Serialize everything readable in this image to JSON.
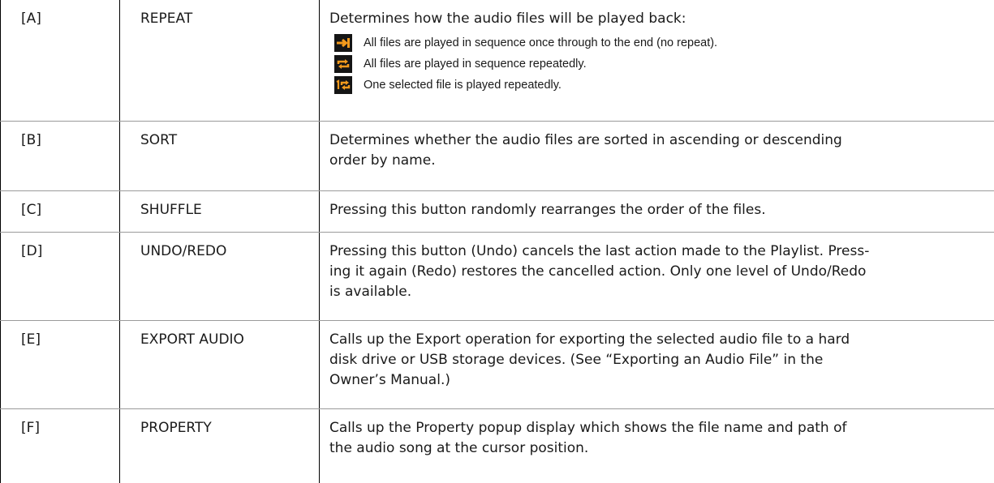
{
  "rows": [
    {
      "key": "[A]",
      "name": "REPEAT",
      "description": "Determines how the audio files will be played back:",
      "modes": [
        {
          "icon": "repeat-off-icon",
          "text": "All files are played in sequence once through to the end (no repeat)."
        },
        {
          "icon": "repeat-all-icon",
          "text": "All files are played in sequence repeatedly."
        },
        {
          "icon": "repeat-one-icon",
          "text": "One selected file is played repeatedly."
        }
      ]
    },
    {
      "key": "[B]",
      "name": "SORT",
      "description_lines": [
        "Determines whether the audio files are sorted in ascending or descending",
        "order by name."
      ]
    },
    {
      "key": "[C]",
      "name": "SHUFFLE",
      "description_lines": [
        "Pressing this button randomly rearranges the order of the files."
      ]
    },
    {
      "key": "[D]",
      "name": "UNDO/REDO",
      "description_lines": [
        "Pressing this button (Undo) cancels the last action made to the Playlist. Press-",
        "ing it again (Redo) restores the cancelled action. Only one level of Undo/Redo",
        "is available."
      ]
    },
    {
      "key": "[E]",
      "name": "EXPORT AUDIO",
      "description_lines": [
        "Calls up the Export operation for exporting the selected audio file to a hard",
        "disk drive or USB storage devices. (See “Exporting an Audio File” in the",
        "Owner’s Manual.)"
      ]
    },
    {
      "key": "[F]",
      "name": "PROPERTY",
      "description_lines": [
        "Calls up the Property popup display which shows the file name and path of",
        "the audio song at the cursor position."
      ]
    }
  ],
  "colors": {
    "icon_background": "#151515",
    "icon_accent": "#f39a1d",
    "row_divider": "#9a9a9a",
    "column_rule": "#000000"
  }
}
